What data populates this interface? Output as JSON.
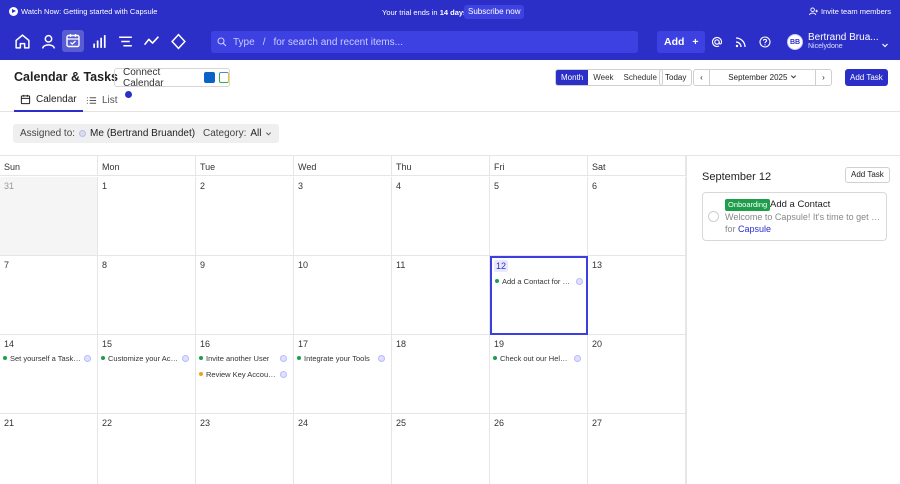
{
  "banner": {
    "watch_label": "Watch Now: Getting started with Capsule",
    "trial_prefix": "Your trial ends in ",
    "trial_days": "14 days",
    "subscribe_label": "Subscribe now",
    "invite_label": "Invite team members"
  },
  "nav": {
    "search_type": "Type",
    "search_slash": "/",
    "search_placeholder": "for search and recent items...",
    "add_label": "Add",
    "add_plus": "+",
    "user_initials": "BB",
    "user_name": "Bertrand Brua...",
    "user_company": "Nicelydone"
  },
  "header": {
    "title": "Calendar & Tasks",
    "connect_label": "Connect Calendar",
    "views": [
      "Month",
      "Week",
      "Schedule"
    ],
    "active_view": "Month",
    "today_label": "Today",
    "prev": "‹",
    "next": "›",
    "month_label": "September 2025",
    "add_task_label": "Add Task"
  },
  "tabs": [
    {
      "label": "Calendar"
    },
    {
      "label": "List"
    }
  ],
  "filters": {
    "assigned_label": "Assigned to:",
    "assigned_value": "Me (Bertrand Bruandet)",
    "category_label": "Category:",
    "category_value": "All"
  },
  "calendar": {
    "weekdays": [
      "Sun",
      "Mon",
      "Tue",
      "Wed",
      "Thu",
      "Fri",
      "Sat"
    ],
    "weeks": [
      [
        "31",
        "1",
        "2",
        "3",
        "4",
        "5",
        "6"
      ],
      [
        "7",
        "8",
        "9",
        "10",
        "11",
        "12",
        "13"
      ],
      [
        "14",
        "15",
        "16",
        "17",
        "18",
        "19",
        "20"
      ],
      [
        "21",
        "22",
        "23",
        "24",
        "25",
        "26",
        "27"
      ]
    ],
    "events": [
      {
        "week": 1,
        "day": 5,
        "slot": 0,
        "label": "Add a Contact for Capsule",
        "color": "#1e9e4a"
      },
      {
        "week": 2,
        "day": 0,
        "slot": 0,
        "label": "Set yourself a Task to…",
        "color": "#1e9e4a"
      },
      {
        "week": 2,
        "day": 1,
        "slot": 0,
        "label": "Customize your Account",
        "color": "#1e9e4a"
      },
      {
        "week": 2,
        "day": 2,
        "slot": 0,
        "label": "Invite another User",
        "color": "#1e9e4a"
      },
      {
        "week": 2,
        "day": 2,
        "slot": 1,
        "label": "Review Key Account…",
        "color": "#f0a020"
      },
      {
        "week": 2,
        "day": 3,
        "slot": 0,
        "label": "Integrate your Tools",
        "color": "#1e9e4a"
      },
      {
        "week": 2,
        "day": 5,
        "slot": 0,
        "label": "Check out our Help Centre",
        "color": "#1e9e4a"
      }
    ]
  },
  "panel": {
    "date": "September 12",
    "add_task_label": "Add Task",
    "task": {
      "tag": "Onboarding",
      "title": "Add a Contact",
      "description": "Welcome to Capsule! It's time to get s...",
      "for_prefix": "for ",
      "for_link": "Capsule"
    }
  }
}
